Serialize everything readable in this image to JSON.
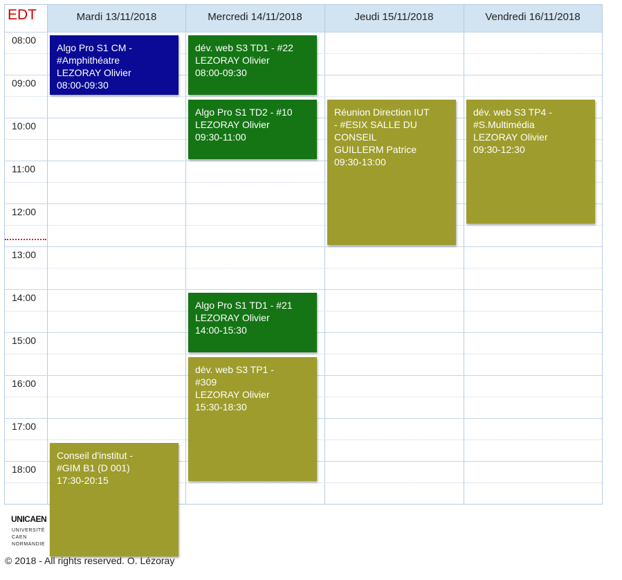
{
  "title": "EDT",
  "days": [
    {
      "label": "Mardi 13/11/2018"
    },
    {
      "label": "Mercredi 14/11/2018"
    },
    {
      "label": "Jeudi 15/11/2018"
    },
    {
      "label": "Vendredi 16/11/2018"
    }
  ],
  "hours": [
    "08:00",
    "09:00",
    "10:00",
    "11:00",
    "12:00",
    "13:00",
    "14:00",
    "15:00",
    "16:00",
    "17:00",
    "18:00"
  ],
  "events": [
    {
      "day": 0,
      "start": "08:00",
      "end": "09:30",
      "color": "#0a0a96",
      "lines": [
        "Algo Pro S1 CM -",
        "#Amphithéatre",
        "LEZORAY Olivier",
        "08:00-09:30"
      ]
    },
    {
      "day": 1,
      "start": "08:00",
      "end": "09:30",
      "color": "#157515",
      "lines": [
        "dév. web S3 TD1 - #22",
        "LEZORAY Olivier",
        "08:00-09:30"
      ]
    },
    {
      "day": 1,
      "start": "09:30",
      "end": "11:00",
      "color": "#157515",
      "lines": [
        "Algo Pro S1 TD2 - #10",
        "LEZORAY Olivier",
        "09:30-11:00"
      ]
    },
    {
      "day": 2,
      "start": "09:30",
      "end": "13:00",
      "color": "#9e9c2c",
      "lines": [
        "Réunion Direction IUT",
        "- #ESIX SALLE DU",
        "CONSEIL",
        "GUILLERM Patrice",
        "09:30-13:00"
      ]
    },
    {
      "day": 3,
      "start": "09:30",
      "end": "12:30",
      "color": "#9e9c2c",
      "lines": [
        "dév. web S3 TP4 -",
        "#S.Multimédia",
        "LEZORAY Olivier",
        "09:30-12:30"
      ]
    },
    {
      "day": 1,
      "start": "14:00",
      "end": "15:30",
      "color": "#157515",
      "lines": [
        "Algo Pro S1 TD1 - #21",
        "LEZORAY Olivier",
        "14:00-15:30"
      ]
    },
    {
      "day": 1,
      "start": "15:30",
      "end": "18:30",
      "color": "#9e9c2c",
      "lines": [
        "dév. web S3 TP1 -",
        "#309",
        "LEZORAY Olivier",
        "15:30-18:30"
      ]
    },
    {
      "day": 0,
      "start": "17:30",
      "end": "20:15",
      "color": "#9e9c2c",
      "lines": [
        "Conseil d'institut -",
        "#GIM B1 (D 001)",
        "17:30-20:15"
      ]
    }
  ],
  "logo": {
    "word": "UNICAEN",
    "lines": [
      "UNIVERSITÉ",
      "CAEN",
      "NORMANDIE"
    ]
  },
  "footer": "© 2018 - All rights reserved. O. Lézoray",
  "colors": {
    "header_bg": "#d2e3f1",
    "title_red": "#d00000",
    "blue_event": "#0a0a96",
    "green_event": "#157515",
    "olive_event": "#9e9c2c"
  }
}
